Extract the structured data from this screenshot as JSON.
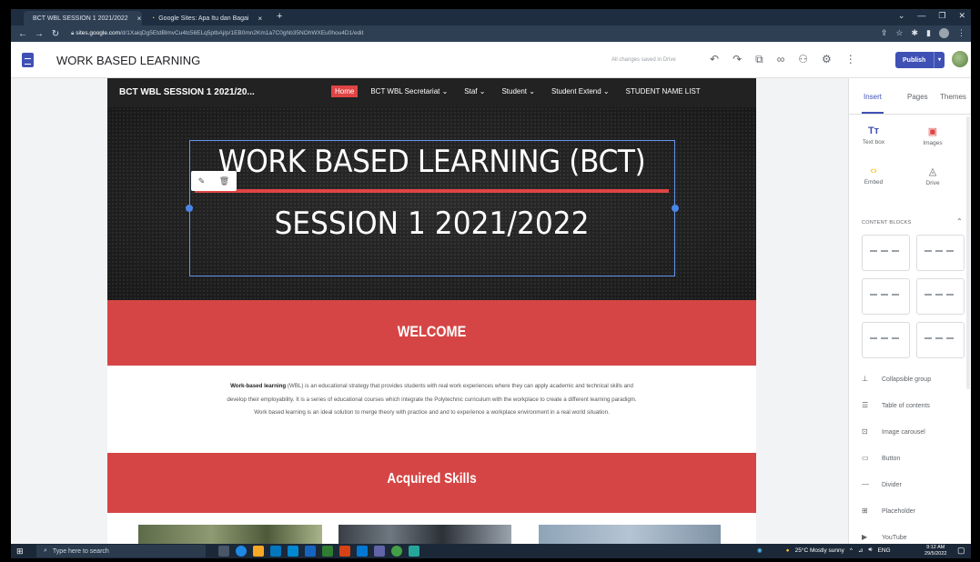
{
  "browser": {
    "tabs": [
      {
        "label": "BCT WBL SESSION 1 2021/2022",
        "active": true
      },
      {
        "label": "Google Sites: Apa Itu dan Bagai",
        "active": false
      }
    ],
    "url_host": "sites.google.com",
    "url_path": "/d/1XaiqDg5EtdBlmvCu4tc56ELq5ptbAj/p/1EB0mn2Km1a7C0ghb35NOhWXEu0hou4D1/edit"
  },
  "sites_header": {
    "site_name": "WORK BASED LEARNING",
    "saved_status": "All changes saved in Drive",
    "publish_label": "Publish"
  },
  "site": {
    "title": "BCT WBL SESSION 1 2021/20...",
    "menu": [
      "Home",
      "BCT WBL Secretariat ⌄",
      "Staf ⌄",
      "Student ⌄",
      "Student Extend ⌄",
      "STUDENT NAME LIST"
    ],
    "hero_line1": "WORK BASED LEARNING (BCT)",
    "hero_line2": "SESSION 1 2021/2022",
    "welcome_heading": "WELCOME",
    "intro_bold": "Work-based learning",
    "intro_rest": " (WBL) is an educational strategy that provides students with real work experiences where they can apply academic and technical skills and develop their employability. It is a series of educational courses which integrate the Polytechnic curriculum with the workplace to create a different learning paradigm. Work based learning is an ideal solution to merge theory with practice and and to experience a workplace environment in a real world situation.",
    "skills_heading": "Acquired Skills"
  },
  "panel": {
    "tabs": [
      "Insert",
      "Pages",
      "Themes"
    ],
    "insert_items": [
      {
        "label": "Text box",
        "icon": "text-box-icon"
      },
      {
        "label": "Images",
        "icon": "image-icon"
      },
      {
        "label": "Embed",
        "icon": "embed-icon"
      },
      {
        "label": "Drive",
        "icon": "drive-icon"
      }
    ],
    "content_blocks_label": "CONTENT BLOCKS",
    "components": [
      {
        "label": "Collapsible group",
        "icon": "collapsible-icon"
      },
      {
        "label": "Table of contents",
        "icon": "toc-icon"
      },
      {
        "label": "Image carousel",
        "icon": "carousel-icon"
      },
      {
        "label": "Button",
        "icon": "button-icon"
      },
      {
        "label": "Divider",
        "icon": "divider-icon"
      },
      {
        "label": "Placeholder",
        "icon": "placeholder-icon"
      },
      {
        "label": "YouTube",
        "icon": "youtube-icon"
      }
    ]
  },
  "taskbar": {
    "search_placeholder": "Type here to search",
    "weather": "25°C  Mostly sunny",
    "language": "ENG",
    "time": "9:12 AM",
    "date": "29/5/2022"
  },
  "colors": {
    "accent": "#3f51b5",
    "site_red": "#d64545",
    "hero_dark": "#262626"
  }
}
